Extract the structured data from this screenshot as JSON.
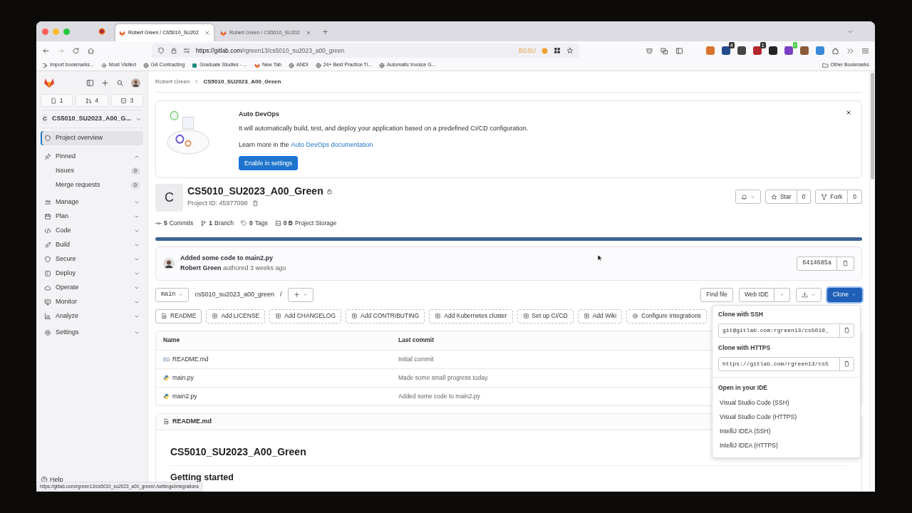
{
  "browser": {
    "tabs": [
      {
        "title": "Robert Green / CS5010_SU202",
        "selected": true
      },
      {
        "title": "Robert Green / CS5010_SU202",
        "selected": false
      }
    ],
    "url_host": "https://gitlab.com",
    "url_path": "/rgreen13/cs5010_su2023_a00_green",
    "profile_label": "BGSU",
    "extensions": [
      {
        "color": "#d9732b"
      },
      {
        "color": "#234a8a",
        "badge": "4"
      },
      {
        "color": "#444444"
      },
      {
        "color": "#b3262c",
        "badge": "1"
      },
      {
        "color": "#222222"
      },
      {
        "color": "#7a3fc4",
        "badge": "!"
      },
      {
        "color": "#8a5a3a"
      },
      {
        "color": "#3a8ad8"
      }
    ],
    "bookmarks": [
      "Import bookmarks...",
      "Most Visited",
      "GA Contracting",
      "Graduate Studies - ...",
      "New Tab",
      "ANDI",
      "24+ Best Practice Ti...",
      "Automatic Invoice G..."
    ],
    "other_bookmarks": "Other Bookmarks"
  },
  "sidebar": {
    "counters": [
      "1",
      "4",
      "3"
    ],
    "project_initial": "C",
    "project_name": "CS5010_SU2023_A00_G...",
    "items": [
      {
        "kind": "link",
        "label": "Project overview",
        "selected": true
      },
      {
        "kind": "section",
        "label": "Pinned",
        "expanded": true,
        "children": [
          {
            "label": "Issues",
            "count": "0"
          },
          {
            "label": "Merge requests",
            "count": "0"
          }
        ]
      },
      {
        "kind": "section",
        "label": "Manage",
        "expanded": false
      },
      {
        "kind": "section",
        "label": "Plan",
        "expanded": false
      },
      {
        "kind": "section",
        "label": "Code",
        "expanded": false
      },
      {
        "kind": "section",
        "label": "Build",
        "expanded": false
      },
      {
        "kind": "section",
        "label": "Secure",
        "expanded": false
      },
      {
        "kind": "section",
        "label": "Deploy",
        "expanded": false
      },
      {
        "kind": "section",
        "label": "Operate",
        "expanded": false
      },
      {
        "kind": "section",
        "label": "Monitor",
        "expanded": false
      },
      {
        "kind": "section",
        "label": "Analyze",
        "expanded": false
      },
      {
        "kind": "section",
        "label": "Settings",
        "expanded": false
      }
    ],
    "help": "Help"
  },
  "breadcrumb": [
    "Robert Green",
    "CS5010_SU2023_A00_Green"
  ],
  "banner": {
    "title": "Auto DevOps",
    "text": "It will automatically build, test, and deploy your application based on a predefined CI/CD configuration.",
    "learn_prefix": "Learn more in the",
    "learn_link": "Auto DevOps documentation",
    "button": "Enable in settings"
  },
  "project": {
    "initial": "C",
    "name": "CS5010_SU2023_A00_Green",
    "id_label": "Project ID: 45977098",
    "stats": [
      {
        "count": "5",
        "label": "Commits"
      },
      {
        "count": "1",
        "label": "Branch"
      },
      {
        "count": "0",
        "label": "Tags"
      },
      {
        "count": "0 B",
        "label": "Project Storage"
      }
    ],
    "star": "Star",
    "star_count": "0",
    "fork": "Fork",
    "fork_count": "0"
  },
  "commit": {
    "title": "Added some code to main2.py",
    "author": "Robert Green",
    "meta": "authored 3 weeks ago",
    "sha": "6414685a"
  },
  "repo": {
    "branch": "main",
    "path": "cs5010_su2023_a00_green",
    "separator": "/",
    "find_file": "Find file",
    "web_ide": "Web IDE",
    "clone": "Clone"
  },
  "shortcuts": [
    {
      "kind": "existing",
      "label": "README"
    },
    {
      "kind": "add",
      "label": "Add LICENSE"
    },
    {
      "kind": "add",
      "label": "Add CHANGELOG"
    },
    {
      "kind": "add",
      "label": "Add CONTRIBUTING"
    },
    {
      "kind": "add",
      "label": "Add Kubernetes cluster"
    },
    {
      "kind": "add",
      "label": "Set up CI/CD"
    },
    {
      "kind": "add",
      "label": "Add Wiki"
    },
    {
      "kind": "settings",
      "label": "Configure Integrations"
    }
  ],
  "table": {
    "columns": [
      "Name",
      "Last commit"
    ],
    "rows": [
      {
        "kind": "markdown",
        "name": "README.md",
        "commit": "Initial commit"
      },
      {
        "kind": "python",
        "name": "main.py",
        "commit": "Made some small progress today."
      },
      {
        "kind": "python",
        "name": "main2.py",
        "commit": "Added some code to main2.py"
      }
    ]
  },
  "readme": {
    "file": "README.md",
    "heading": "CS5010_SU2023_A00_Green",
    "subheading": "Getting started"
  },
  "clone_menu": {
    "ssh_label": "Clone with SSH",
    "ssh_url": "git@gitlab.com:rgreen13/cs5010_",
    "https_label": "Clone with HTTPS",
    "https_url": "https://gitlab.com/rgreen13/cs5",
    "ide_label": "Open in your IDE",
    "ide_items": [
      "Visual Studio Code (SSH)",
      "Visual Studio Code (HTTPS)",
      "IntelliJ IDEA (SSH)",
      "IntelliJ IDEA (HTTPS)"
    ]
  },
  "status_url": "https://gitlab.com/rgreen13/cs5010_su2023_a00_green/-/settings/integrations"
}
